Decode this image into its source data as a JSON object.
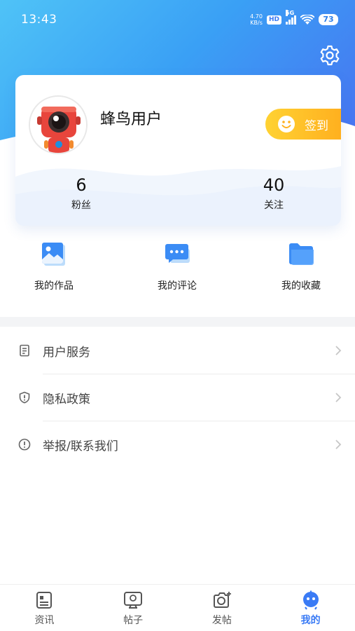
{
  "status_bar": {
    "time": "13:43",
    "net_speed_value": "4.70",
    "net_speed_unit": "KB/s",
    "hd_badge": "HD",
    "network_type": "5G",
    "battery": "73"
  },
  "profile": {
    "username": "蜂鸟用户",
    "checkin_label": "签到",
    "fans_count": "6",
    "fans_label": "粉丝",
    "follow_count": "40",
    "follow_label": "关注"
  },
  "shortcuts": [
    {
      "label": "我的作品",
      "icon": "picture-icon"
    },
    {
      "label": "我的评论",
      "icon": "comment-icon"
    },
    {
      "label": "我的收藏",
      "icon": "folder-icon"
    }
  ],
  "menu": [
    {
      "label": "用户服务",
      "icon": "document-icon"
    },
    {
      "label": "隐私政策",
      "icon": "shield-icon"
    },
    {
      "label": "举报/联系我们",
      "icon": "alert-icon"
    }
  ],
  "bottom_nav": [
    {
      "label": "资讯",
      "icon": "news-icon",
      "active": false
    },
    {
      "label": "帖子",
      "icon": "post-icon",
      "active": false
    },
    {
      "label": "发帖",
      "icon": "camera-icon",
      "active": false
    },
    {
      "label": "我的",
      "icon": "robot-icon",
      "active": true
    }
  ],
  "colors": {
    "accent": "#3a7bf5",
    "header_gradient_start": "#4fc3f7",
    "header_gradient_end": "#4a6cf0",
    "checkin_gradient_start": "#ffd233",
    "checkin_gradient_end": "#ffb01f"
  }
}
